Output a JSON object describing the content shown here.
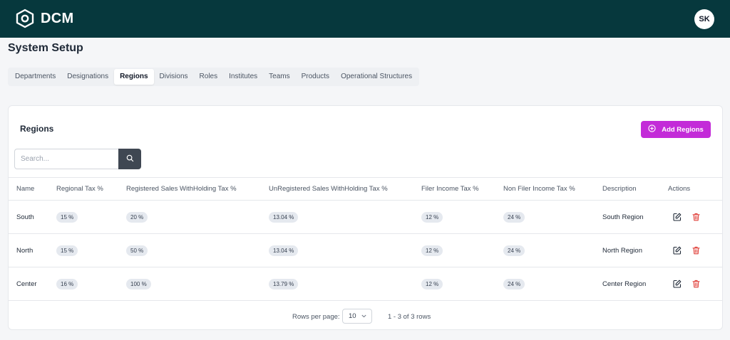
{
  "header": {
    "brand": "DCM",
    "avatar_initials": "SK"
  },
  "page_title": "System Setup",
  "tabs": [
    {
      "label": "Departments",
      "active": false
    },
    {
      "label": "Designations",
      "active": false
    },
    {
      "label": "Regions",
      "active": true
    },
    {
      "label": "Divisions",
      "active": false
    },
    {
      "label": "Roles",
      "active": false
    },
    {
      "label": "Institutes",
      "active": false
    },
    {
      "label": "Teams",
      "active": false
    },
    {
      "label": "Products",
      "active": false
    },
    {
      "label": "Operational Structures",
      "active": false
    }
  ],
  "card": {
    "title": "Regions",
    "add_button": "Add Regions",
    "search_placeholder": "Search..."
  },
  "table": {
    "columns": [
      "Name",
      "Regional Tax %",
      "Registered Sales WithHolding Tax %",
      "UnRegistered Sales WithHolding Tax %",
      "Filer Income Tax %",
      "Non Filer Income Tax %",
      "Description",
      "Actions"
    ],
    "rows": [
      {
        "name": "South",
        "regional_tax": "15 %",
        "registered_wht": "20 %",
        "unregistered_wht": "13.04 %",
        "filer_tax": "12 %",
        "non_filer_tax": "24 %",
        "description": "South Region"
      },
      {
        "name": "North",
        "regional_tax": "15 %",
        "registered_wht": "50 %",
        "unregistered_wht": "13.04 %",
        "filer_tax": "12 %",
        "non_filer_tax": "24 %",
        "description": "North Region"
      },
      {
        "name": "Center",
        "regional_tax": "16 %",
        "registered_wht": "100 %",
        "unregistered_wht": "13.79 %",
        "filer_tax": "12 %",
        "non_filer_tax": "24 %",
        "description": "Center Region"
      }
    ]
  },
  "pagination": {
    "rows_per_page_label": "Rows per page:",
    "rows_per_page_value": "10",
    "range_text": "1 - 3 of 3 rows"
  },
  "colors": {
    "header_bg": "#06383d",
    "accent": "#c32bd8",
    "delete": "#e0403a"
  },
  "icons": [
    "hexagon-logo-icon",
    "plus-circle-icon",
    "search-icon",
    "edit-icon",
    "trash-icon",
    "chevron-down-icon"
  ]
}
